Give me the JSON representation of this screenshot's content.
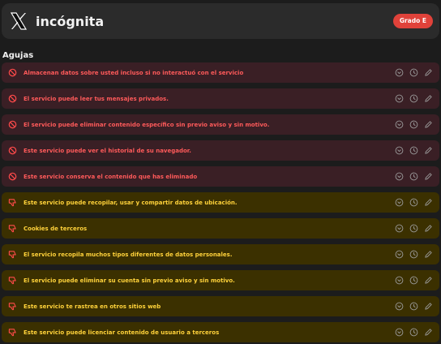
{
  "header": {
    "app_name": "incógnita",
    "grade_label": "Grado E",
    "icons": {
      "logo": "x-logo-icon"
    }
  },
  "section": {
    "title": "Agujas"
  },
  "colors": {
    "red_bg": "#3a1f25",
    "red_text": "#ff5a5a",
    "yellow_bg": "#3b3000",
    "yellow_text": "#ffd23a",
    "grade_bg": "#e0423a"
  },
  "items": [
    {
      "label": "Almacenan datos sobre usted incluso si no interactuó con el servicio",
      "severity": "red",
      "icon": "blocked-icon"
    },
    {
      "label": "El servicio puede leer tus mensajes privados.",
      "severity": "red",
      "icon": "blocked-icon"
    },
    {
      "label": "El servicio puede eliminar contenido específico sin previo aviso y sin motivo.",
      "severity": "red",
      "icon": "blocked-icon"
    },
    {
      "label": "Este servicio puede ver el historial de su navegador.",
      "severity": "red",
      "icon": "blocked-icon"
    },
    {
      "label": "Este servicio conserva el contenido que has eliminado",
      "severity": "red",
      "icon": "blocked-icon"
    },
    {
      "label": "Este servicio puede recopilar, usar y compartir datos de ubicación.",
      "severity": "yellow",
      "icon": "thumbs-down-icon"
    },
    {
      "label": "Cookies de terceros",
      "severity": "yellow",
      "icon": "thumbs-down-icon"
    },
    {
      "label": "El servicio recopila muchos tipos diferentes de datos personales.",
      "severity": "yellow",
      "icon": "thumbs-down-icon"
    },
    {
      "label": "El servicio puede eliminar su cuenta sin previo aviso y sin motivo.",
      "severity": "yellow",
      "icon": "thumbs-down-icon"
    },
    {
      "label": "Este servicio te rastrea en otros sitios web",
      "severity": "yellow",
      "icon": "thumbs-down-icon"
    },
    {
      "label": "Este servicio puede licenciar contenido de usuario a terceros",
      "severity": "yellow",
      "icon": "thumbs-down-icon"
    }
  ],
  "row_actions": [
    "expand-icon",
    "history-icon",
    "edit-icon"
  ]
}
